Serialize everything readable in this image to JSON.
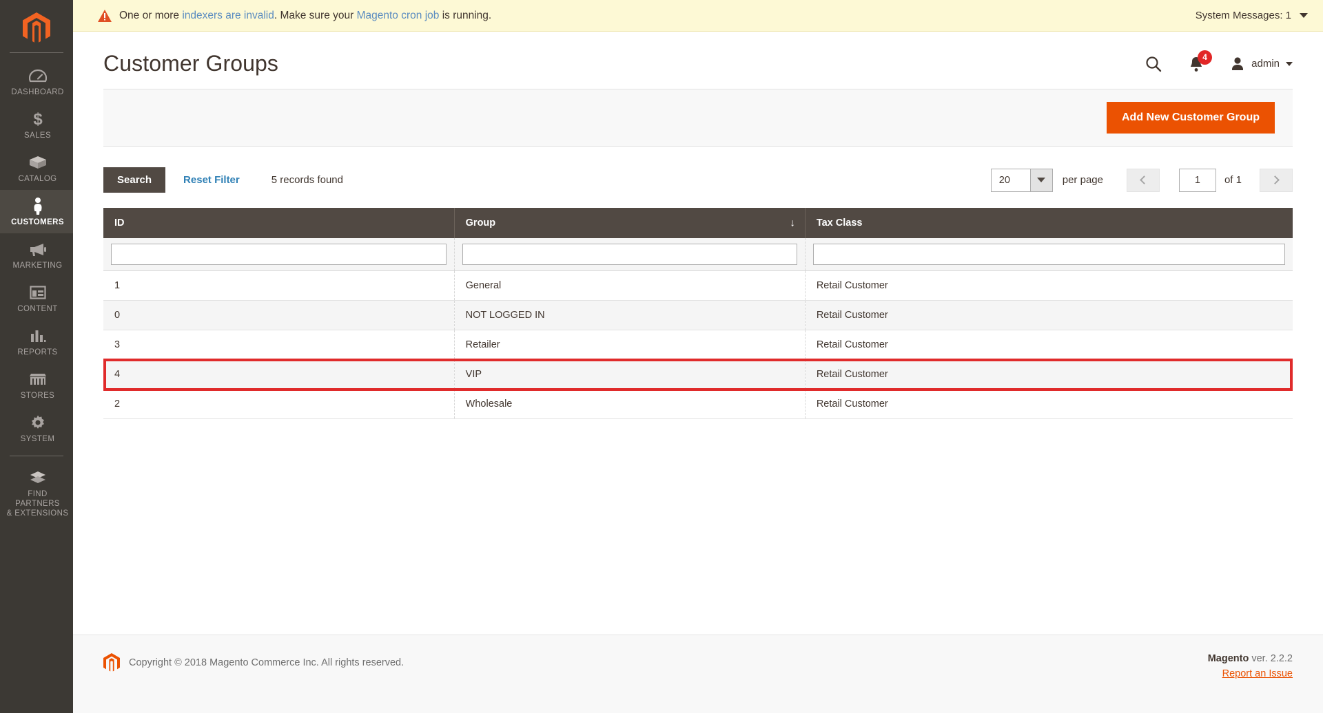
{
  "sidebar": {
    "logo": "magento-logo",
    "items": [
      {
        "label": "DASHBOARD",
        "icon": "dashboard-icon",
        "active": false
      },
      {
        "label": "SALES",
        "icon": "dollar-icon",
        "active": false
      },
      {
        "label": "CATALOG",
        "icon": "box-icon",
        "active": false
      },
      {
        "label": "CUSTOMERS",
        "icon": "person-icon",
        "active": true
      },
      {
        "label": "MARKETING",
        "icon": "megaphone-icon",
        "active": false
      },
      {
        "label": "CONTENT",
        "icon": "layout-icon",
        "active": false
      },
      {
        "label": "REPORTS",
        "icon": "bar-chart-icon",
        "active": false
      },
      {
        "label": "STORES",
        "icon": "storefront-icon",
        "active": false
      },
      {
        "label": "SYSTEM",
        "icon": "gear-icon",
        "active": false
      },
      {
        "label": "FIND PARTNERS\n& EXTENSIONS",
        "label_line1": "FIND PARTNERS",
        "label_line2": "& EXTENSIONS",
        "icon": "extension-icon",
        "active": false
      }
    ]
  },
  "message_bar": {
    "icon": "warning-triangle-icon",
    "text_part1": "One or more ",
    "link1": "indexers are invalid",
    "text_part2": ". Make sure your ",
    "link2": "Magento cron job",
    "text_part3": " is running.",
    "system_messages_label": "System Messages: 1",
    "background_color": "#fdf9d5"
  },
  "header": {
    "title": "Customer Groups",
    "search_icon": "search-icon",
    "notifications": {
      "icon": "bell-icon",
      "count": "4",
      "badge_color": "#e22626"
    },
    "user": {
      "icon": "user-avatar-icon",
      "name": "admin"
    }
  },
  "page_actions": {
    "add_button_label": "Add New Customer Group",
    "add_button_color": "#eb5202"
  },
  "grid_toolbar": {
    "search_label": "Search",
    "reset_filter_label": "Reset Filter",
    "records_found": "5 records found",
    "per_page_value": "20",
    "per_page_label": "per page",
    "page_value": "1",
    "of_label": "of 1",
    "prev_icon": "chevron-left-icon",
    "next_icon": "chevron-right-icon"
  },
  "grid": {
    "columns": [
      {
        "label": "ID",
        "sorted": false
      },
      {
        "label": "Group",
        "sorted": true,
        "sort_direction": "↓"
      },
      {
        "label": "Tax Class",
        "sorted": false
      }
    ],
    "filters": [
      {
        "value": "",
        "placeholder": ""
      },
      {
        "value": "",
        "placeholder": ""
      },
      {
        "value": "",
        "placeholder": ""
      }
    ],
    "rows": [
      {
        "id": "1",
        "group": "General",
        "tax_class": "Retail Customer",
        "highlighted": false
      },
      {
        "id": "0",
        "group": "NOT LOGGED IN",
        "tax_class": "Retail Customer",
        "highlighted": false
      },
      {
        "id": "3",
        "group": "Retailer",
        "tax_class": "Retail Customer",
        "highlighted": false
      },
      {
        "id": "4",
        "group": "VIP",
        "tax_class": "Retail Customer",
        "highlighted": true
      },
      {
        "id": "2",
        "group": "Wholesale",
        "tax_class": "Retail Customer",
        "highlighted": false
      }
    ],
    "highlight_color": "#e02b2b"
  },
  "footer": {
    "logo": "magento-logo",
    "copyright": "Copyright © 2018 Magento Commerce Inc. All rights reserved.",
    "version_brand": "Magento",
    "version_text": " ver. 2.2.2",
    "report_link": "Report an Issue"
  }
}
